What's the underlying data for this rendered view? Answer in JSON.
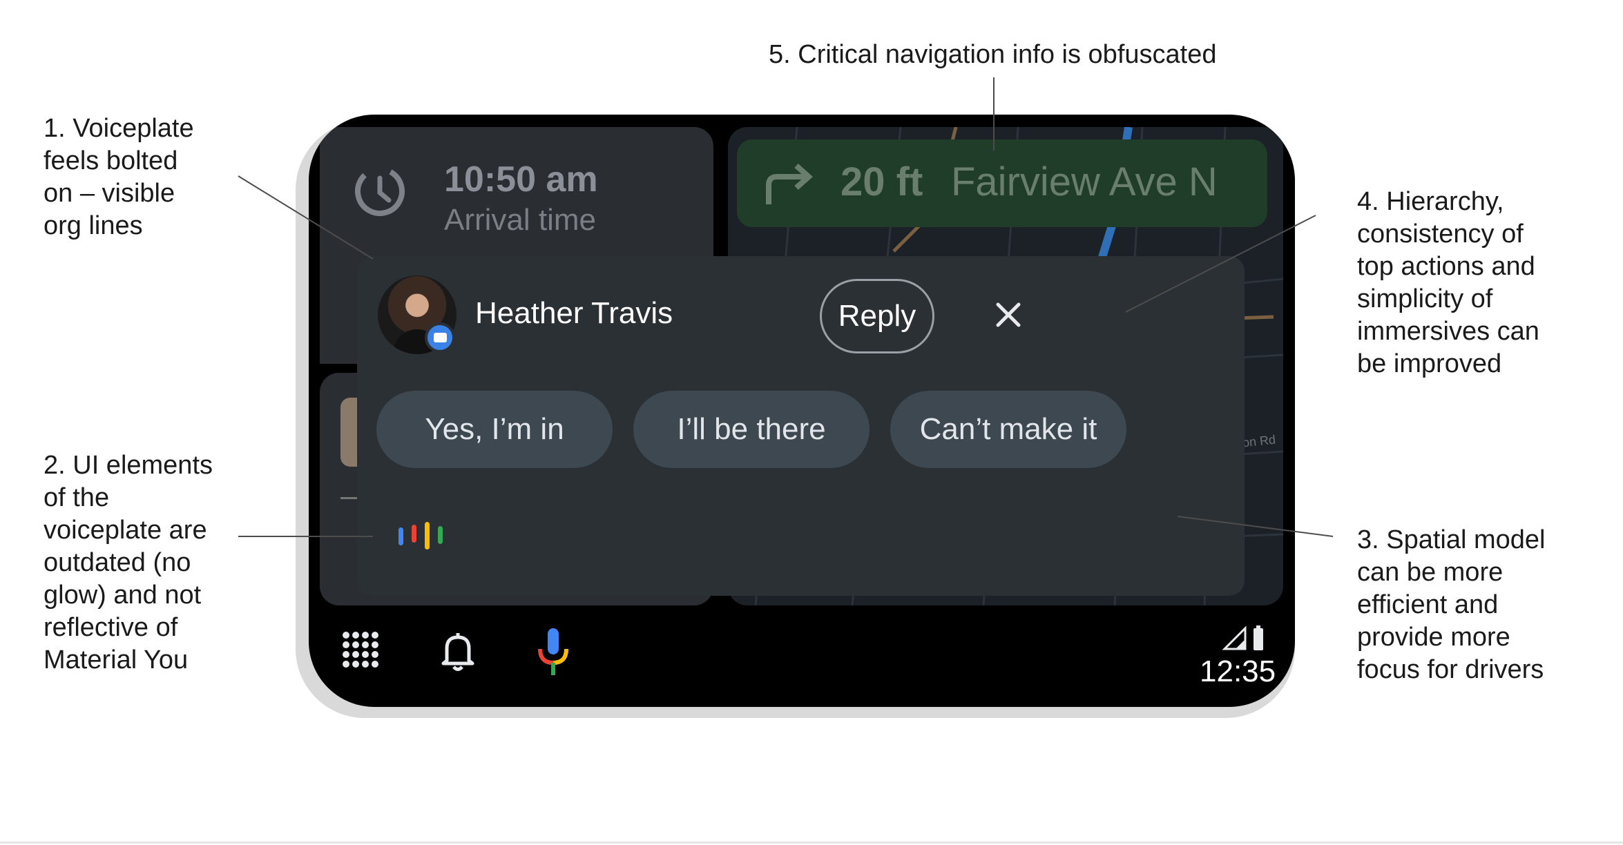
{
  "annotations": {
    "a1": "1. Voiceplate\nfeels bolted\non – visible\norg lines",
    "a2": "2. UI elements\nof the\nvoiceplate are\noutdated (no\nglow) and not\nreflective of\nMaterial You",
    "a3": "3. Spatial model\ncan be more\nefficient and\nprovide more\nfocus for drivers",
    "a4": "4. Hierarchy,\nconsistency of\ntop actions and\nsimplicity of\nimmersives can\nbe improved",
    "a5": "5. Critical navigation info is obfuscated"
  },
  "eta": {
    "time": "10:50 am",
    "label": "Arrival time"
  },
  "navigation": {
    "distance": "20 ft",
    "street": "Fairview Ave N",
    "map_label": "on Rd"
  },
  "notification": {
    "sender": "Heather Travis",
    "reply_label": "Reply",
    "chips": [
      "Yes, I’m in",
      "I’ll be there",
      "Can’t make it"
    ]
  },
  "status_bar": {
    "clock": "12:35"
  },
  "colors": {
    "assistant_blue": "#4285F4",
    "assistant_red": "#EA4335",
    "assistant_yellow": "#FBBC04",
    "assistant_green": "#34A853",
    "nav_banner": "#1f3d28"
  },
  "icons": [
    "eta-clock-icon",
    "turn-right-icon",
    "message-badge-icon",
    "close-icon",
    "assistant-icon",
    "apps-grid-icon",
    "bell-icon",
    "mic-icon",
    "signal-icon",
    "battery-icon"
  ]
}
